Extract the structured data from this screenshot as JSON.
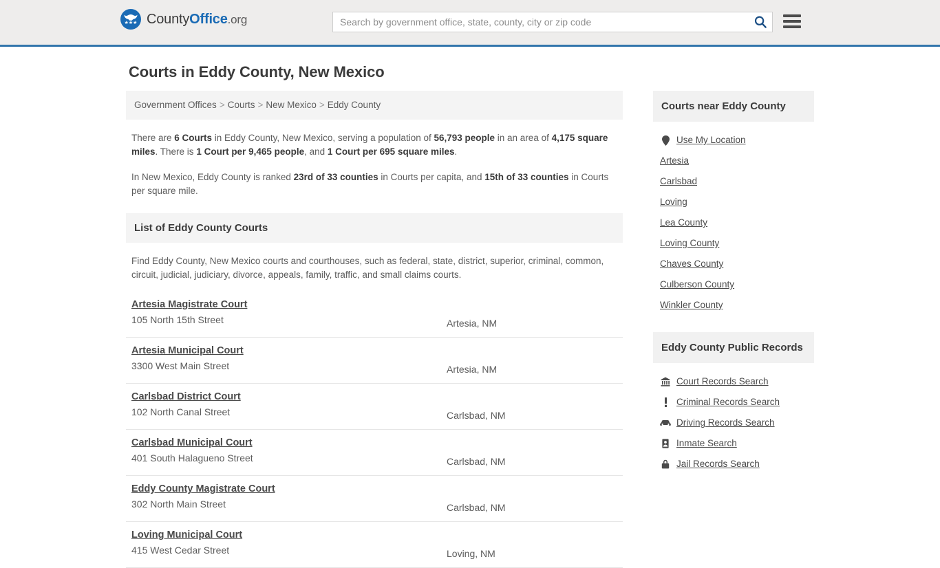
{
  "header": {
    "brand": {
      "part1": "County",
      "part2": "Office",
      "part3": ".org"
    },
    "search": {
      "placeholder": "Search by government office, state, county, city or zip code",
      "value": "",
      "button_label": "Search"
    },
    "menu_label": "Menu",
    "accent_color": "#3275ab",
    "background": "#eeedec"
  },
  "page": {
    "title": "Courts in Eddy County, New Mexico"
  },
  "breadcrumb": {
    "items": [
      {
        "label": "Government Offices"
      },
      {
        "label": "Courts"
      },
      {
        "label": "New Mexico"
      },
      {
        "label": "Eddy County"
      }
    ],
    "separator": ">"
  },
  "intro": {
    "p1_a": "There are ",
    "p1_b1": "6 Courts",
    "p1_c": " in Eddy County, New Mexico, serving a population of ",
    "p1_b2": "56,793 people",
    "p1_d": " in an area of ",
    "p1_b3": "4,175 square miles",
    "p1_e": ". There is ",
    "p1_b4": "1 Court per 9,465 people",
    "p1_f": ", and ",
    "p1_b5": "1 Court per 695 square miles",
    "p1_g": ".",
    "p2_a": "In New Mexico, Eddy County is ranked ",
    "p2_b1": "23rd of 33 counties",
    "p2_c": " in Courts per capita, and ",
    "p2_b2": "15th of 33 counties",
    "p2_d": " in Courts per square mile."
  },
  "list_section": {
    "heading": "List of Eddy County Courts",
    "description": "Find Eddy County, New Mexico courts and courthouses, such as federal, state, district, superior, criminal, common, circuit, judicial, judiciary, divorce, appeals, family, traffic, and small claims courts."
  },
  "courts": [
    {
      "name": "Artesia Magistrate Court",
      "address": "105 North 15th Street",
      "city": "Artesia, NM"
    },
    {
      "name": "Artesia Municipal Court",
      "address": "3300 West Main Street",
      "city": "Artesia, NM"
    },
    {
      "name": "Carlsbad District Court",
      "address": "102 North Canal Street",
      "city": "Carlsbad, NM"
    },
    {
      "name": "Carlsbad Municipal Court",
      "address": "401 South Halagueno Street",
      "city": "Carlsbad, NM"
    },
    {
      "name": "Eddy County Magistrate Court",
      "address": "302 North Main Street",
      "city": "Carlsbad, NM"
    },
    {
      "name": "Loving Municipal Court",
      "address": "415 West Cedar Street",
      "city": "Loving, NM"
    }
  ],
  "nearby": {
    "heading": "Courts near Eddy County",
    "items": [
      {
        "label": "Use My Location",
        "icon": "map-pin-icon"
      },
      {
        "label": "Artesia",
        "icon": ""
      },
      {
        "label": "Carlsbad",
        "icon": ""
      },
      {
        "label": "Loving",
        "icon": ""
      },
      {
        "label": "Lea County",
        "icon": ""
      },
      {
        "label": "Loving County",
        "icon": ""
      },
      {
        "label": "Chaves County",
        "icon": ""
      },
      {
        "label": "Culberson County",
        "icon": ""
      },
      {
        "label": "Winkler County",
        "icon": ""
      }
    ]
  },
  "public_records": {
    "heading": "Eddy County Public Records",
    "items": [
      {
        "label": "Court Records Search",
        "icon": "courthouse-icon"
      },
      {
        "label": "Criminal Records Search",
        "icon": "exclamation-icon"
      },
      {
        "label": "Driving Records Search",
        "icon": "car-icon"
      },
      {
        "label": "Inmate Search",
        "icon": "id-card-icon"
      },
      {
        "label": "Jail Records Search",
        "icon": "lock-icon"
      }
    ]
  }
}
